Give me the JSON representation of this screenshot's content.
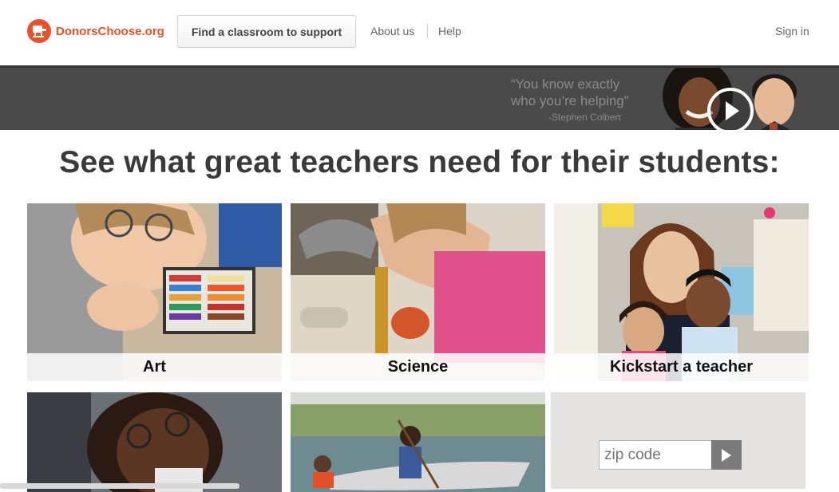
{
  "header": {
    "logo_text": "DonorsChoose.org",
    "find_button": "Find a classroom to support",
    "nav": [
      "About us",
      "Help"
    ],
    "sign_in": "Sign in"
  },
  "banner": {
    "quote_line1": "“You know exactly",
    "quote_line2": "who you’re helping”",
    "quote_attribution": "-Stephen Colbert",
    "play_icon": "play-icon"
  },
  "main": {
    "headline": "See what great teachers need for their students:",
    "categories": [
      {
        "label": "Art"
      },
      {
        "label": "Science"
      },
      {
        "label": "Kickstart a teacher"
      }
    ]
  },
  "zip": {
    "placeholder": "zip code",
    "go_icon": "arrow-right-icon"
  },
  "colors": {
    "brand": "#e8512a",
    "banner_bg": "#4a4a4a",
    "text_dark": "#3a3a3a"
  }
}
